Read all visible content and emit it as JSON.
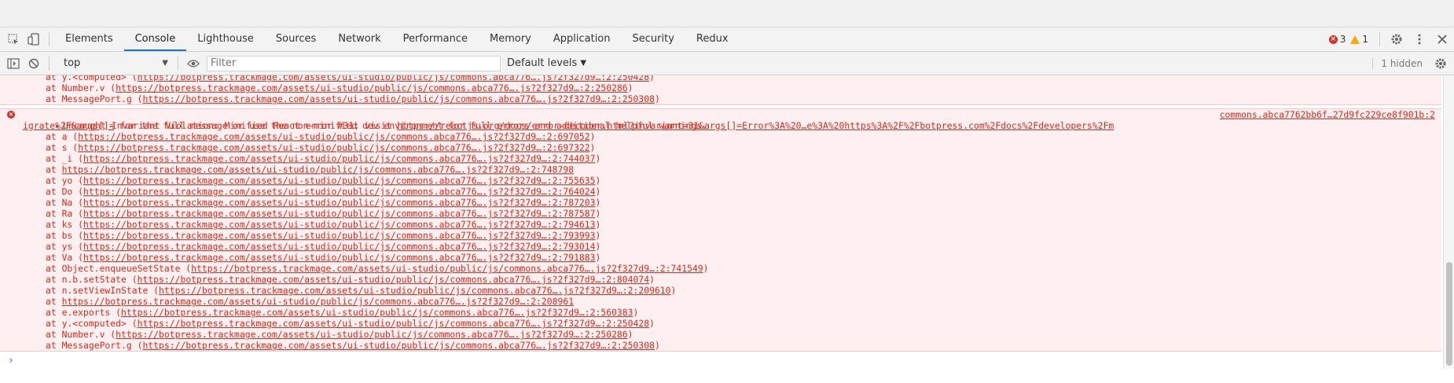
{
  "tabs": [
    {
      "label": "Elements",
      "active": false
    },
    {
      "label": "Console",
      "active": true
    },
    {
      "label": "Lighthouse",
      "active": false
    },
    {
      "label": "Sources",
      "active": false
    },
    {
      "label": "Network",
      "active": false
    },
    {
      "label": "Performance",
      "active": false
    },
    {
      "label": "Memory",
      "active": false
    },
    {
      "label": "Application",
      "active": false
    },
    {
      "label": "Security",
      "active": false
    },
    {
      "label": "Redux",
      "active": false
    }
  ],
  "status": {
    "errors": "3",
    "warnings": "1"
  },
  "toolbar": {
    "context": "top",
    "filter_placeholder": "Filter",
    "levels": "Default levels",
    "hidden": "1 hidden"
  },
  "colors": {
    "error_text": "#d52b1e",
    "error_bg": "#fef0f0",
    "accent": "#1a73e8"
  },
  "console": {
    "prev_lines": [
      {
        "prefix": "at y.<computed> (",
        "link": "https://botpress.trackmage.com/assets/ui-studio/public/js/commons.abca776….js?2f327d9…:2:250428",
        "suffix": ")"
      },
      {
        "prefix": "at Number.v (",
        "link": "https://botpress.trackmage.com/assets/ui-studio/public/js/commons.abca776….js?2f327d9…:2:250286",
        "suffix": ")"
      },
      {
        "prefix": "at MessagePort.g (",
        "link": "https://botpress.trackmage.com/assets/ui-studio/public/js/commons.abca776….js?2f327d9…:2:250308",
        "suffix": ")"
      }
    ],
    "error": {
      "head_text": "Uncaught Invariant Violation: Minified React error #31; visit ",
      "head_link": "https://reactjs.org/docs/error-decoder.html?invariant=31&args[]=Error%3A%20…e%3A%20https%3A%2F%2Fbotpress.com%2Fdocs%2Fdevelopers%2Fm",
      "source": "commons.abca7762bb6f…27d9fc229ce8f901b:2",
      "second_link": "igrate%2F&args[]=",
      "second_text": " for the full message or use the non-minified dev environment for full errors and additional helpful warnings.",
      "stack": [
        {
          "prefix": "at a (",
          "link": "https://botpress.trackmage.com/assets/ui-studio/public/js/commons.abca776….js?2f327d9…:2:697052",
          "suffix": ")"
        },
        {
          "prefix": "at s (",
          "link": "https://botpress.trackmage.com/assets/ui-studio/public/js/commons.abca776….js?2f327d9…:2:697322",
          "suffix": ")"
        },
        {
          "prefix": "at _i (",
          "link": "https://botpress.trackmage.com/assets/ui-studio/public/js/commons.abca776….js?2f327d9…:2:744037",
          "suffix": ")"
        },
        {
          "prefix": "at ",
          "link": "https://botpress.trackmage.com/assets/ui-studio/public/js/commons.abca776….js?2f327d9…:2:748798",
          "suffix": ""
        },
        {
          "prefix": "at yo (",
          "link": "https://botpress.trackmage.com/assets/ui-studio/public/js/commons.abca776….js?2f327d9…:2:755635",
          "suffix": ")"
        },
        {
          "prefix": "at Do (",
          "link": "https://botpress.trackmage.com/assets/ui-studio/public/js/commons.abca776….js?2f327d9…:2:764024",
          "suffix": ")"
        },
        {
          "prefix": "at Na (",
          "link": "https://botpress.trackmage.com/assets/ui-studio/public/js/commons.abca776….js?2f327d9…:2:787203",
          "suffix": ")"
        },
        {
          "prefix": "at Ra (",
          "link": "https://botpress.trackmage.com/assets/ui-studio/public/js/commons.abca776….js?2f327d9…:2:787587",
          "suffix": ")"
        },
        {
          "prefix": "at ks (",
          "link": "https://botpress.trackmage.com/assets/ui-studio/public/js/commons.abca776….js?2f327d9…:2:794613",
          "suffix": ")"
        },
        {
          "prefix": "at bs (",
          "link": "https://botpress.trackmage.com/assets/ui-studio/public/js/commons.abca776….js?2f327d9…:2:793993",
          "suffix": ")"
        },
        {
          "prefix": "at ys (",
          "link": "https://botpress.trackmage.com/assets/ui-studio/public/js/commons.abca776….js?2f327d9…:2:793014",
          "suffix": ")"
        },
        {
          "prefix": "at Va (",
          "link": "https://botpress.trackmage.com/assets/ui-studio/public/js/commons.abca776….js?2f327d9…:2:791883",
          "suffix": ")"
        },
        {
          "prefix": "at Object.enqueueSetState (",
          "link": "https://botpress.trackmage.com/assets/ui-studio/public/js/commons.abca776….js?2f327d9…:2:741549",
          "suffix": ")"
        },
        {
          "prefix": "at n.b.setState (",
          "link": "https://botpress.trackmage.com/assets/ui-studio/public/js/commons.abca776….js?2f327d9…:2:804074",
          "suffix": ")"
        },
        {
          "prefix": "at n.setViewInState (",
          "link": "https://botpress.trackmage.com/assets/ui-studio/public/js/commons.abca776….js?2f327d9…:2:209610",
          "suffix": ")"
        },
        {
          "prefix": "at ",
          "link": "https://botpress.trackmage.com/assets/ui-studio/public/js/commons.abca776….js?2f327d9…:2:208961",
          "suffix": ""
        },
        {
          "prefix": "at e.exports (",
          "link": "https://botpress.trackmage.com/assets/ui-studio/public/js/commons.abca776….js?2f327d9…:2:560383",
          "suffix": ")"
        },
        {
          "prefix": "at y.<computed> (",
          "link": "https://botpress.trackmage.com/assets/ui-studio/public/js/commons.abca776….js?2f327d9…:2:250428",
          "suffix": ")"
        },
        {
          "prefix": "at Number.v (",
          "link": "https://botpress.trackmage.com/assets/ui-studio/public/js/commons.abca776….js?2f327d9…:2:250286",
          "suffix": ")"
        },
        {
          "prefix": "at MessagePort.g (",
          "link": "https://botpress.trackmage.com/assets/ui-studio/public/js/commons.abca776….js?2f327d9…:2:250308",
          "suffix": ")"
        }
      ]
    },
    "prompt": "›"
  }
}
